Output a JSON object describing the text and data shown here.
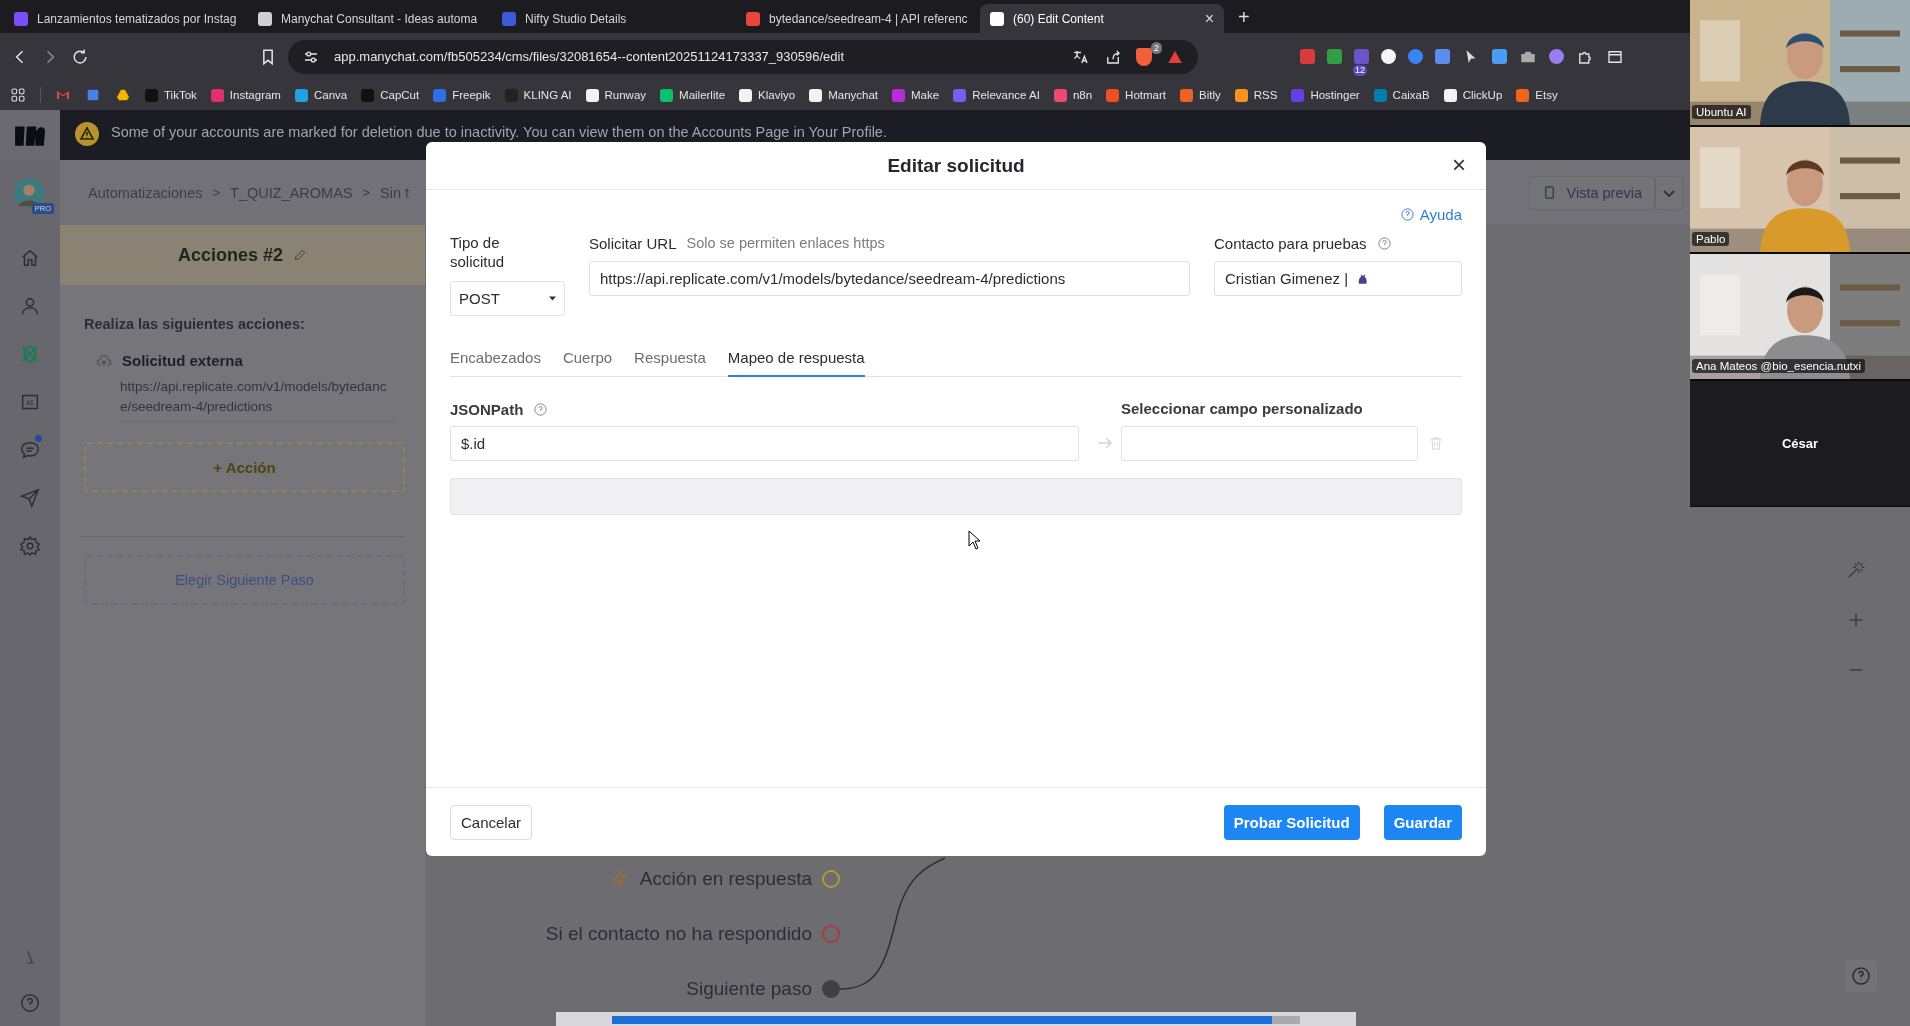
{
  "browser": {
    "tabs": [
      {
        "title": "Lanzamientos tematizados por Instag",
        "color": "#7c4dff",
        "selected": false
      },
      {
        "title": "Manychat Consultant - Ideas automa",
        "color": "#d0d0d0",
        "selected": false
      },
      {
        "title": "Nifty Studio Details",
        "color": "#3b5bdb",
        "selected": false
      },
      {
        "title": "bytedance/seedream-4 | API referenc",
        "color": "#e8453c",
        "selected": false
      },
      {
        "title": "(60) Edit Content",
        "color": "#ffffff",
        "selected": true
      }
    ],
    "new_tab": "+",
    "close": "×",
    "address": "app.manychat.com/fb505234/cms/files/32081654--content20251124173337_930596/edit",
    "shield_badge": "2",
    "extension_badge": "12",
    "bookmarks": [
      {
        "label": "TikTok",
        "color": "#111111"
      },
      {
        "label": "Instagram",
        "color": "#e1306c"
      },
      {
        "label": "Canva",
        "color": "#1fa3e0"
      },
      {
        "label": "CapCut",
        "color": "#111111"
      },
      {
        "label": "Freepik",
        "color": "#2f6fe4"
      },
      {
        "label": "KLING AI",
        "color": "#222222"
      },
      {
        "label": "Runway",
        "color": "#f2f2f2"
      },
      {
        "label": "Mailerlite",
        "color": "#09c269"
      },
      {
        "label": "Klaviyo",
        "color": "#f2f2f2"
      },
      {
        "label": "Manychat",
        "color": "#f2f2f2"
      },
      {
        "label": "Make",
        "color": "#b92bd9"
      },
      {
        "label": "Relevance AI",
        "color": "#7b5cf0"
      },
      {
        "label": "n8n",
        "color": "#ea4b71"
      },
      {
        "label": "Hotmart",
        "color": "#f04e23"
      },
      {
        "label": "Bitly",
        "color": "#ee6123"
      },
      {
        "label": "RSS",
        "color": "#f7931e"
      },
      {
        "label": "Hostinger",
        "color": "#673de6"
      },
      {
        "label": "CaixaB",
        "color": "#007eae"
      },
      {
        "label": "ClickUp",
        "color": "#f2f2f2"
      },
      {
        "label": "Etsy",
        "color": "#f1641e"
      }
    ]
  },
  "app": {
    "nav": [
      {
        "kind": "home",
        "selected": false
      },
      {
        "kind": "contacts",
        "selected": false
      },
      {
        "kind": "automation",
        "selected": true
      },
      {
        "kind": "ai",
        "label": "AI",
        "selected": false
      },
      {
        "kind": "chat",
        "selected": false,
        "notification": true
      },
      {
        "kind": "broadcast",
        "selected": false
      },
      {
        "kind": "settings",
        "selected": false
      }
    ],
    "pro_badge": "PRO",
    "banner": "Some of your accounts are marked for deletion due to inactivity. You can view them on the Accounts Page in Your Profile.",
    "breadcrumb": [
      "Automatizaciones",
      "T_QUIZ_AROMAS",
      "Sin t"
    ],
    "breadcrumb_separator": ">",
    "preview_button": "Vista previa",
    "step": {
      "title": "Acciones #2",
      "intro": "Realiza las siguientes acciones:",
      "action_title": "Solicitud externa",
      "action_url": "https://api.replicate.com/v1/models/bytedance/seedream-4/predictions",
      "add_action": "+ Acción",
      "next_step": "Elegir Siguiente Paso"
    },
    "outputs": [
      {
        "label": "Acción en respuesta",
        "kind": "response"
      },
      {
        "label": "Si el contacto no ha respondido",
        "kind": "no_reply"
      },
      {
        "label": "Siguiente paso",
        "kind": "next"
      }
    ]
  },
  "modal": {
    "title": "Editar solicitud",
    "close": "×",
    "help_link": "Ayuda",
    "type_label": "Tipo de solicitud",
    "type_value": "POST",
    "url_label": "Solicitar URL",
    "url_hint": "Solo se permiten enlaces https",
    "url_value": "https://api.replicate.com/v1/models/bytedance/seedream-4/predictions",
    "contact_label": "Contacto para pruebas",
    "contact_value": "Cristian Gimenez |",
    "tabs": [
      {
        "label": "Encabezados",
        "selected": false
      },
      {
        "label": "Cuerpo",
        "selected": false
      },
      {
        "label": "Respuesta",
        "selected": false
      },
      {
        "label": "Mapeo de respuesta",
        "selected": true
      }
    ],
    "jsonpath_label": "JSONPath",
    "jsonpath_value": "$.id",
    "field_label": "Seleccionar campo personalizado",
    "cancel": "Cancelar",
    "test": "Probar Solicitud",
    "save": "Guardar"
  },
  "video_call": {
    "participants": [
      {
        "name": "Ubuntu AI",
        "video": true
      },
      {
        "name": "Pablo",
        "video": true
      },
      {
        "name": "Ana Mateos @bio_esencia.nutxi",
        "video": true
      },
      {
        "name": "César",
        "video": false
      }
    ]
  },
  "player": {
    "level": 0.96
  }
}
